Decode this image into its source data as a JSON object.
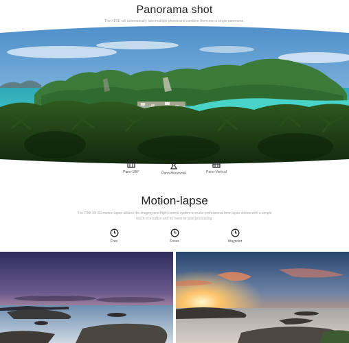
{
  "panorama": {
    "title": "Panorama shot",
    "description": "The X8SE will automatically take multiple photos and combine them into a single panorama.",
    "modes": [
      {
        "icon": "pano-180-icon",
        "label": "Pano-180°"
      },
      {
        "icon": "pano-horizontal-icon",
        "label": "Pano-Horizontal"
      },
      {
        "icon": "pano-vertical-icon",
        "label": "Pano-Vertical"
      }
    ]
  },
  "motion_lapse": {
    "title": "Motion-lapse",
    "description": "The FIMI X8 SE motion-lapse utilizes the imaging and flight control system to make professional time-lapse videos with a simple touch of a button and no need for post processing.",
    "modes": [
      {
        "icon": "free-timer-icon",
        "label": "Free"
      },
      {
        "icon": "focus-timer-icon",
        "label": "Focus"
      },
      {
        "icon": "waypoint-timer-icon",
        "label": "Waypoint"
      }
    ]
  },
  "colors": {
    "title": "#1e1e1e",
    "description": "#a9a9a9",
    "sea": "#38c6c8",
    "sky": "#6ea8d8"
  }
}
